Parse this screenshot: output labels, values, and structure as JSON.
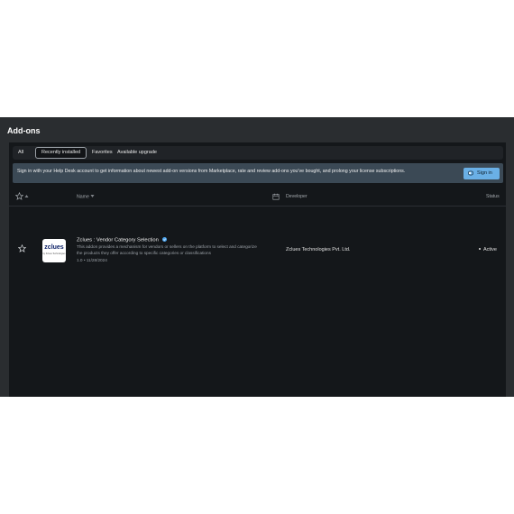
{
  "page": {
    "title": "Add-ons"
  },
  "tabs": [
    {
      "label": "All"
    },
    {
      "label": "Recently installed",
      "active": true
    },
    {
      "label": "Favorites"
    },
    {
      "label": "Available upgrade"
    }
  ],
  "banner": {
    "text": "Sign in with your Help Desk account to get information about newest add-on versions from Marketplace, rate and review add-ons you've bought, and prolong your license subscriptions.",
    "button_label": "Sign in"
  },
  "table": {
    "headers": {
      "name": "Name",
      "developer": "Developer",
      "status": "Status"
    },
    "rows": [
      {
        "logo_text": "zclues",
        "logo_subtext": "by Zclues Technologies",
        "name": "Zclues : Vendor Category Selection",
        "description": "This addon provides a mechanism for vendors or sellers on the platform to select and categorize the products they offer according to specific categories or classifications",
        "meta": "1.0 • 11/28/2024",
        "developer": "Zclues Technologies Pvt. Ltd.",
        "status": "Active"
      }
    ]
  },
  "colors": {
    "background": "#14171a",
    "frame": "#2a2d30",
    "banner": "#3b4955",
    "accent": "#6ab0e6",
    "verified": "#4ea7f2"
  },
  "icons": {
    "favorite_header": "star-outline-icon",
    "sort": "sort-arrow-icon",
    "calendar": "calendar-icon",
    "row_favorite": "star-outline-icon",
    "verified": "verified-check-icon",
    "sign_in": "toggle-icon"
  }
}
